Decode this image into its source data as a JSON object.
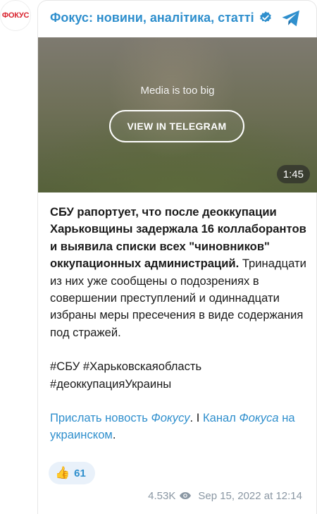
{
  "channel": {
    "avatar_text": "ФОКУС",
    "title": "Фокус: новини, аналітика, статті",
    "verified_icon": "verified-badge-icon",
    "telegram_icon": "telegram-plane-icon"
  },
  "media": {
    "message": "Media is too big",
    "button_label": "VIEW IN TELEGRAM",
    "duration": "1:45"
  },
  "post": {
    "bold_text": "СБУ рапортует, что после деоккупации Харьковщины задержала 16 коллаборантов и выявила списки всех \"чиновников\" оккупационных администраций.",
    "body_text": " Тринадцати из них уже сообщены о подозрениях в совершении преступлений и одиннадцати избраны меры пресечения в виде содержания под стражей.",
    "hashtags_line1": "#СБУ #Харьковскаяобласть",
    "hashtags_line2": "#деоккупацияУкраины",
    "link1_a": "Прислать новость ",
    "link1_b": "Фокусу",
    "separator": ". I ",
    "link2_a": "Канал ",
    "link2_b": "Фокуса",
    "link2_c": " на украинском",
    "end_dot": "."
  },
  "reaction": {
    "emoji": "👍",
    "count": "61"
  },
  "meta": {
    "views": "4.53K",
    "date": "Sep 15, 2022 at 12:14"
  },
  "colors": {
    "accent": "#2f8fcd",
    "brand_red": "#d9232e",
    "muted": "#8a97a3"
  }
}
